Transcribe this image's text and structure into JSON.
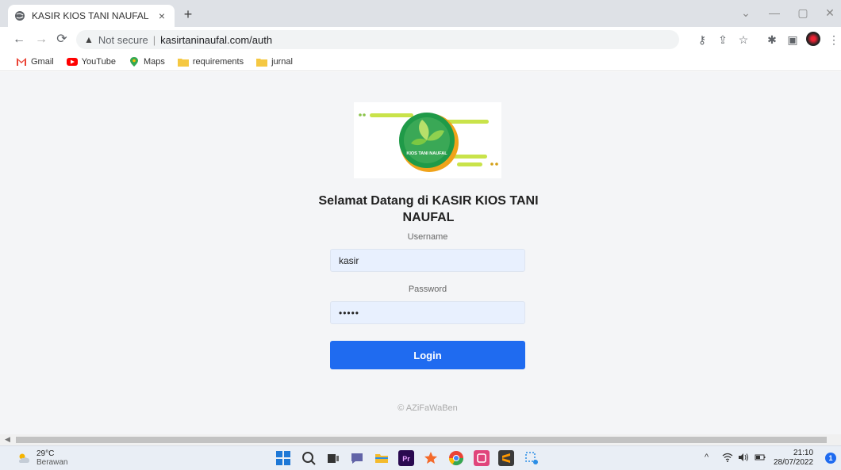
{
  "browser": {
    "tab": {
      "title": "KASIR KIOS TANI NAUFAL",
      "close": "×"
    },
    "new_tab": "+",
    "controls": {
      "chevron": "⌄",
      "minimize": "—",
      "maximize": "▢",
      "close": "✕"
    },
    "address": {
      "security_label": "Not secure",
      "separator": "|",
      "url": "kasirtaninaufal.com/auth"
    },
    "bookmarks": [
      {
        "label": "Gmail",
        "color": "#ea4335"
      },
      {
        "label": "YouTube",
        "color": "#ff0000"
      },
      {
        "label": "Maps",
        "color": "#34a853"
      },
      {
        "label": "requirements",
        "color": "#f5c842"
      },
      {
        "label": "jurnal",
        "color": "#f5c842"
      }
    ]
  },
  "page": {
    "logo_text": "KIOS TANI NAUFAL",
    "welcome": "Selamat Datang di KASIR KIOS TANI NAUFAL",
    "username_label": "Username",
    "username_value": "kasir",
    "password_label": "Password",
    "password_value": "•••••",
    "login_label": "Login",
    "footer": "© AZiFaWaBen",
    "colors": {
      "primary": "#1f6bf0",
      "input_bg": "#e8f0fe",
      "page_bg": "#f4f5f7"
    }
  },
  "taskbar": {
    "weather": {
      "temp": "29°C",
      "condition": "Berawan"
    },
    "apps": [
      {
        "name": "windows",
        "color": "#1e78d6"
      },
      {
        "name": "search",
        "color": "#333333"
      },
      {
        "name": "task-view",
        "color": "#333333"
      },
      {
        "name": "chat",
        "color": "#6264a7"
      },
      {
        "name": "file-explorer",
        "color": "#f4bb2d"
      },
      {
        "name": "premiere",
        "color": "#2a0a50"
      },
      {
        "name": "favorite",
        "color": "#f46a2b"
      },
      {
        "name": "chrome",
        "color": "#ea4335"
      },
      {
        "name": "app-pink",
        "color": "#e0457b"
      },
      {
        "name": "sublime",
        "color": "#ff9800"
      },
      {
        "name": "snipping",
        "color": "#2b8ee6"
      }
    ],
    "tray": {
      "chevron": "^",
      "time": "21:10",
      "date": "28/07/2022",
      "notifications": "1"
    }
  }
}
